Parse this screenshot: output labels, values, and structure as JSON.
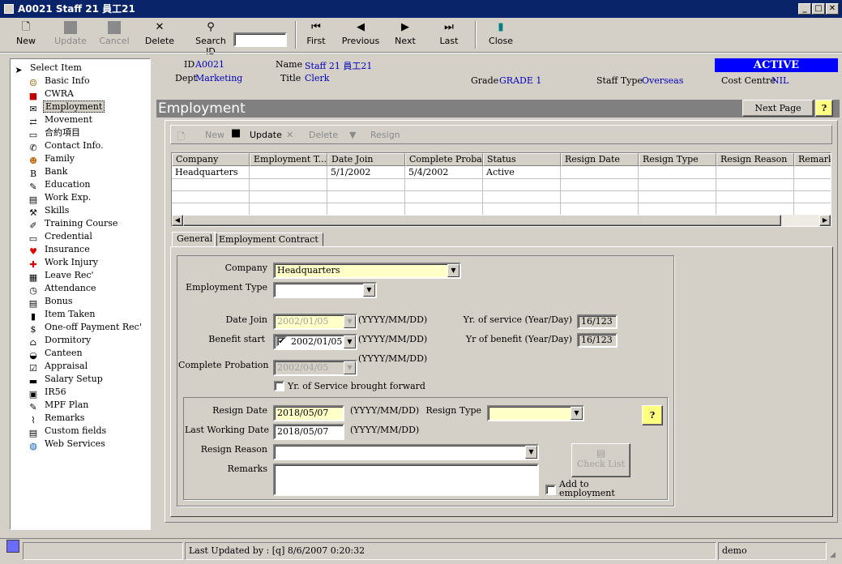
{
  "window": {
    "title": "A0021 Staff 21 員工21",
    "minimize": "_",
    "maximize": "□",
    "close": "✕"
  },
  "toolbar": {
    "new": "New",
    "update": "Update",
    "cancel": "Cancel",
    "delete": "Delete",
    "search_id_label": "Search ID",
    "search_id_value": "",
    "first": "First",
    "previous": "Previous",
    "next": "Next",
    "last": "Last",
    "close": "Close"
  },
  "tree": {
    "root": "Select Item",
    "items": [
      "Basic Info",
      "CWRA",
      "Employment",
      "Movement",
      "合約項目",
      "Contact Info.",
      "Family",
      "Bank",
      "Education",
      "Work Exp.",
      "Skills",
      "Training Course",
      "Credential",
      "Insurance",
      "Work Injury",
      "Leave Rec'",
      "Attendance",
      "Bonus",
      "Item Taken",
      "One-off Payment Rec'",
      "Dormitory",
      "Canteen",
      "Appraisal",
      "Salary Setup",
      "IR56",
      "MPF Plan",
      "Remarks",
      "Custom fields",
      "Web Services"
    ],
    "selected": "Employment"
  },
  "header": {
    "id_label": "ID",
    "id_value": "A0021",
    "dept_label": "Dept",
    "dept_value": "Marketing",
    "name_label": "Name",
    "name_value": "Staff 21  員工21",
    "title_label": "Title",
    "title_value": "Clerk",
    "grade_label": "Grade",
    "grade_value": "GRADE 1",
    "stafftype_label": "Staff Type",
    "stafftype_value": "Overseas",
    "costcentre_label": "Cost Centre",
    "costcentre_value": "NIL",
    "status": "ACTIVE"
  },
  "section": {
    "title": "Employment",
    "next_page": "Next Page",
    "help": "?"
  },
  "subtoolbar": {
    "new": "New",
    "update": "Update",
    "delete": "Delete",
    "resign": "Resign"
  },
  "grid": {
    "columns": [
      "Company",
      "Employment T...",
      "Date Join",
      "Complete Proba...",
      "Status",
      "Resign Date",
      "Resign Type",
      "Resign Reason",
      "Remarks"
    ],
    "rows": [
      [
        "Headquarters",
        "",
        "5/1/2002",
        "5/4/2002",
        "Active",
        "",
        "",
        "",
        ""
      ]
    ]
  },
  "tabs": {
    "general": "General",
    "contract": "Employment Contract"
  },
  "form": {
    "company_label": "Company",
    "company_value": "Headquarters",
    "emptype_label": "Employment Type",
    "emptype_value": "",
    "datejoin_label": "Date Join",
    "datejoin_value": "2002/01/05",
    "benefit_label": "Benefit start",
    "benefit_value": "2002/01/05",
    "probation_label": "Complete Probation",
    "probation_value": "2002/04/05",
    "date_fmt": "(YYYY/MM/DD)",
    "yos_label": "Yr. of service (Year/Day)",
    "yos_value": "16/123",
    "yob_label": "Yr of benefit (Year/Day)",
    "yob_value": "16/123",
    "yos_forward_label": "Yr. of Service brought forward",
    "resign_date_label": "Resign Date",
    "resign_date_value": "2018/05/07",
    "lastwork_label": "Last Working Date",
    "lastwork_value": "2018/05/07",
    "resign_type_label": "Resign Type",
    "resign_type_value": "",
    "resign_reason_label": "Resign Reason",
    "resign_reason_value": "",
    "remarks_label": "Remarks",
    "remarks_value": "",
    "checklist": "Check List",
    "blacklist_label": "Add to employment blacklist",
    "help": "?"
  },
  "status": {
    "updated": "Last Updated by : [q]  8/6/2007 0:20:32",
    "user": "demo"
  }
}
